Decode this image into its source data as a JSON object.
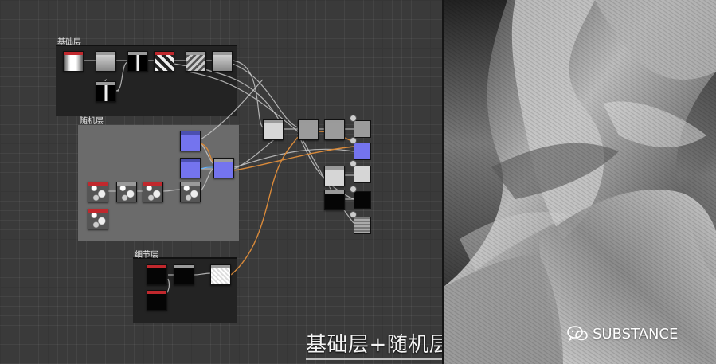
{
  "frames": {
    "base": {
      "title": "基础层"
    },
    "random": {
      "title": "随机层"
    },
    "detail": {
      "title": "细节层"
    }
  },
  "overlay_caption": "基础层+随机层",
  "watermark": {
    "text": "SUBSTANCE",
    "icon": "wechat-icon"
  },
  "colors": {
    "graph_background": "#3a3a3a",
    "frame_dark": "#232323",
    "frame_random": "#6b6b6b",
    "node_header_red": "#c0282d",
    "node_normal_blue": "#7474ee",
    "wire_orange": "#d98a3a",
    "wire_gray": "#c8c8c8"
  }
}
